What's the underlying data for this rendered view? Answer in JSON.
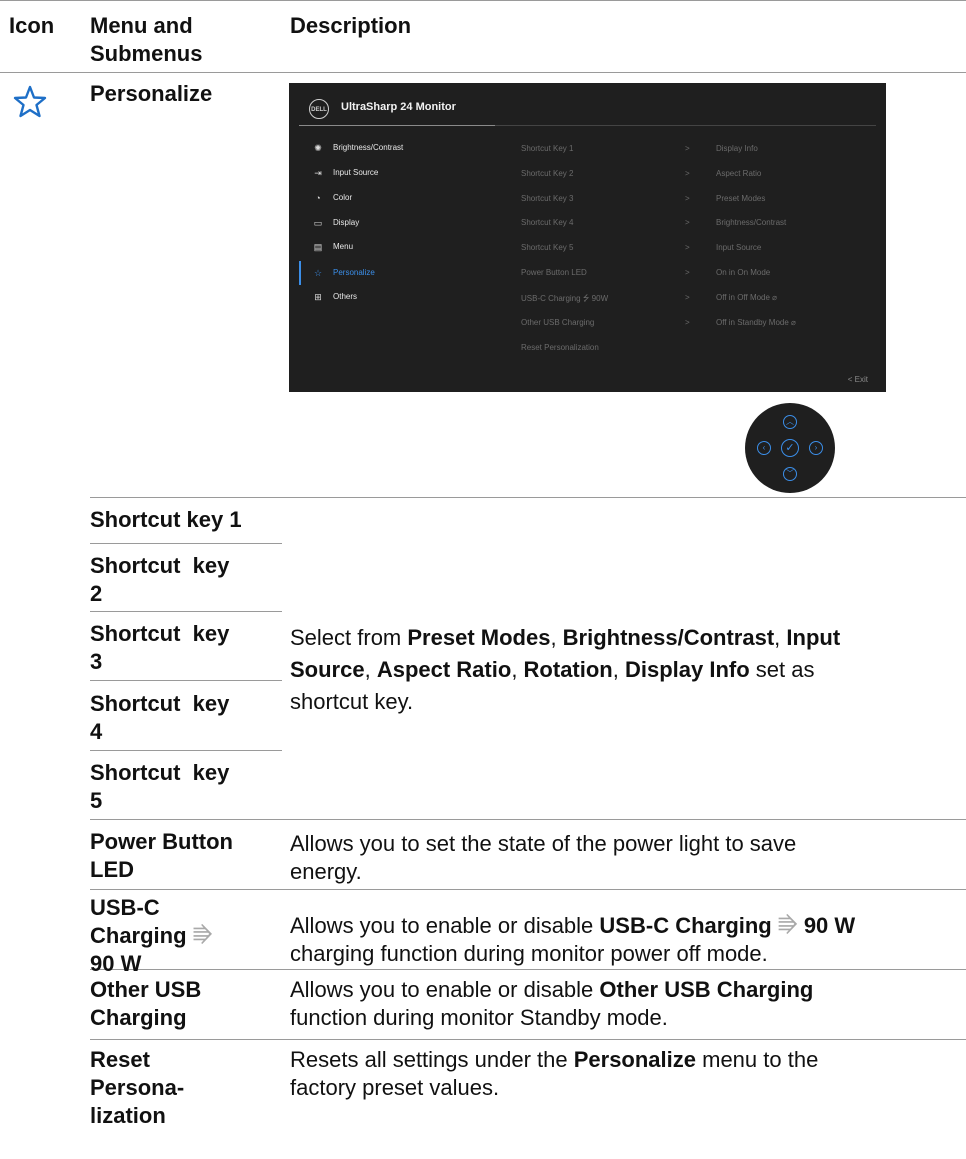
{
  "header": {
    "col_icon": "Icon",
    "col_menu": "Menu and Submenus",
    "col_desc": "Description"
  },
  "personalize_row": {
    "icon": "star-icon",
    "label": "Personalize"
  },
  "osd": {
    "title": "UltraSharp 24 Monitor",
    "logo_text": "DELL",
    "menu_items": [
      {
        "icon": "brightness-icon",
        "label": "Brightness/Contrast"
      },
      {
        "icon": "input-source-icon",
        "label": "Input Source"
      },
      {
        "icon": "color-icon",
        "label": "Color"
      },
      {
        "icon": "display-icon",
        "label": "Display"
      },
      {
        "icon": "menu-icon",
        "label": "Menu"
      },
      {
        "icon": "star-icon",
        "label": "Personalize"
      },
      {
        "icon": "others-icon",
        "label": "Others"
      }
    ],
    "submenu": [
      "Shortcut Key 1",
      "Shortcut Key 2",
      "Shortcut Key 3",
      "Shortcut Key 4",
      "Shortcut Key 5",
      "Power Button LED",
      "USB-C Charging ⭍ 90W",
      "Other USB Charging",
      "Reset Personalization"
    ],
    "values": [
      "Display Info",
      "Aspect Ratio",
      "Preset Modes",
      "Brightness/Contrast",
      "Input Source",
      "On in On Mode",
      "Off in Off Mode ⌀",
      "Off in Standby Mode ⌀"
    ],
    "chevron": ">",
    "exit": "< Exit"
  },
  "rows": {
    "sk1": "Shortcut key 1",
    "sk2a": "Shortcut  key",
    "sk2b": "2",
    "sk3a": "Shortcut  key",
    "sk3b": "3",
    "sk4a": "Shortcut  key",
    "sk4b": "4",
    "sk5a": "Shortcut  key",
    "sk5b": "5",
    "sk_desc": {
      "p1": "Select from ",
      "b1": "Preset Modes",
      "p2": ", ",
      "b2": "Brightness/Contrast",
      "p3": ", ",
      "b3": "Input",
      "b3b": "Source",
      "p4": ", ",
      "b4": "Aspect Ratio",
      "p5": ", ",
      "b5": "Rotation",
      "p6": ", ",
      "b6": "Display Info",
      "p7": " set as",
      "p8": "shortcut key."
    },
    "pbl_a": "Power Button",
    "pbl_b": "LED",
    "pbl_desc_a": "Allows you to set the state of the power light to save",
    "pbl_desc_b": "energy.",
    "usbc_a": "USB-C",
    "usbc_b": "Charging",
    "usbc_c": "90 W",
    "usbc_desc": {
      "p1": "Allows you to enable or disable ",
      "b1": "USB-C Charging",
      "b2": "90 W",
      "p2": "charging function during monitor power off mode."
    },
    "ousb_a": "Other USB",
    "ousb_b": "Charging",
    "ousb_desc": {
      "p1": "Allows you to enable or disable ",
      "b1": "Other USB Charging",
      "p2": "function during monitor Standby mode."
    },
    "reset_a": "Reset",
    "reset_b": "Persona-",
    "reset_c": "lization",
    "reset_desc": {
      "p1": "Resets all settings under the ",
      "b1": "Personalize",
      "p2": " menu to the",
      "p3": "factory preset values."
    }
  }
}
